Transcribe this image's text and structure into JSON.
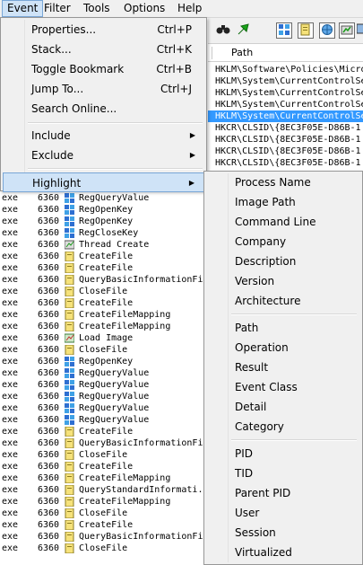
{
  "menubar": [
    {
      "label": "Event",
      "active": true
    },
    {
      "label": "Filter"
    },
    {
      "label": "Tools"
    },
    {
      "label": "Options"
    },
    {
      "label": "Help"
    }
  ],
  "toolbar": {
    "icons": [
      "binoculars-icon",
      "jump-arrow-icon",
      "registry-activity-icon",
      "file-activity-icon",
      "network-activity-icon",
      "process-activity-icon",
      "profiling-icon"
    ]
  },
  "column_header": {
    "path": "Path"
  },
  "path_rows": [
    {
      "text": "HKLM\\Software\\Policies\\Micro",
      "selected": false
    },
    {
      "text": "HKLM\\System\\CurrentControlSe",
      "selected": false
    },
    {
      "text": "HKLM\\System\\CurrentControlSe",
      "selected": false
    },
    {
      "text": "HKLM\\System\\CurrentControlSe",
      "selected": false
    },
    {
      "text": "HKLM\\System\\CurrentControlSe",
      "selected": true
    },
    {
      "text": "HKCR\\CLSID\\{8EC3F05E-D86B-1",
      "selected": false
    },
    {
      "text": "HKCR\\CLSID\\{8EC3F05E-D86B-1",
      "selected": false
    },
    {
      "text": "HKCR\\CLSID\\{8EC3F05E-D86B-1",
      "selected": false
    },
    {
      "text": "HKCR\\CLSID\\{8EC3F05E-D86B-1",
      "selected": false
    }
  ],
  "event_menu": {
    "items": [
      {
        "label": "Properties...",
        "accel": "Ctrl+P"
      },
      {
        "label": "Stack...",
        "accel": "Ctrl+K"
      },
      {
        "label": "Toggle Bookmark",
        "accel": "Ctrl+B"
      },
      {
        "label": "Jump To...",
        "accel": "Ctrl+J"
      },
      {
        "label": "Search Online...",
        "accel": ""
      },
      {
        "label": "Include",
        "accel": "",
        "submenu": true
      },
      {
        "label": "Exclude",
        "accel": "",
        "submenu": true
      },
      {
        "label": "Highlight",
        "accel": "",
        "submenu": true,
        "highlighted": true
      }
    ]
  },
  "highlight_submenu": {
    "groups": [
      [
        "Process Name",
        "Image Path",
        "Command Line",
        "Company",
        "Description",
        "Version",
        "Architecture"
      ],
      [
        "Path",
        "Operation",
        "Result",
        "Event Class",
        "Detail",
        "Category"
      ],
      [
        "PID",
        "TID",
        "Parent PID",
        "User",
        "Session",
        "Virtualized"
      ]
    ]
  },
  "event_rows": [
    {
      "proc": "exe",
      "pid": "6360",
      "icon": "registry-icon",
      "op": "RegQueryValue"
    },
    {
      "proc": "exe",
      "pid": "6360",
      "icon": "registry-icon",
      "op": "RegOpenKey"
    },
    {
      "proc": "exe",
      "pid": "6360",
      "icon": "registry-icon",
      "op": "RegOpenKey"
    },
    {
      "proc": "exe",
      "pid": "6360",
      "icon": "registry-icon",
      "op": "RegCloseKey"
    },
    {
      "proc": "exe",
      "pid": "6360",
      "icon": "thread-icon",
      "op": "Thread Create"
    },
    {
      "proc": "exe",
      "pid": "6360",
      "icon": "file-icon",
      "op": "CreateFile"
    },
    {
      "proc": "exe",
      "pid": "6360",
      "icon": "file-icon",
      "op": "CreateFile"
    },
    {
      "proc": "exe",
      "pid": "6360",
      "icon": "file-icon",
      "op": "QueryBasicInformationFi"
    },
    {
      "proc": "exe",
      "pid": "6360",
      "icon": "file-icon",
      "op": "CloseFile"
    },
    {
      "proc": "exe",
      "pid": "6360",
      "icon": "file-icon",
      "op": "CreateFile"
    },
    {
      "proc": "exe",
      "pid": "6360",
      "icon": "file-icon",
      "op": "CreateFileMapping"
    },
    {
      "proc": "exe",
      "pid": "6360",
      "icon": "file-icon",
      "op": "CreateFileMapping"
    },
    {
      "proc": "exe",
      "pid": "6360",
      "icon": "image-load-icon",
      "op": "Load Image"
    },
    {
      "proc": "exe",
      "pid": "6360",
      "icon": "file-icon",
      "op": "CloseFile"
    },
    {
      "proc": "exe",
      "pid": "6360",
      "icon": "registry-icon",
      "op": "RegOpenKey"
    },
    {
      "proc": "exe",
      "pid": "6360",
      "icon": "registry-icon",
      "op": "RegQueryValue"
    },
    {
      "proc": "exe",
      "pid": "6360",
      "icon": "registry-icon",
      "op": "RegQueryValue"
    },
    {
      "proc": "exe",
      "pid": "6360",
      "icon": "registry-icon",
      "op": "RegQueryValue"
    },
    {
      "proc": "exe",
      "pid": "6360",
      "icon": "registry-icon",
      "op": "RegQueryValue"
    },
    {
      "proc": "exe",
      "pid": "6360",
      "icon": "registry-icon",
      "op": "RegQueryValue"
    },
    {
      "proc": "exe",
      "pid": "6360",
      "icon": "file-icon",
      "op": "CreateFile"
    },
    {
      "proc": "exe",
      "pid": "6360",
      "icon": "file-icon",
      "op": "QueryBasicInformationFi"
    },
    {
      "proc": "exe",
      "pid": "6360",
      "icon": "file-icon",
      "op": "CloseFile"
    },
    {
      "proc": "exe",
      "pid": "6360",
      "icon": "file-icon",
      "op": "CreateFile"
    },
    {
      "proc": "exe",
      "pid": "6360",
      "icon": "file-icon",
      "op": "CreateFileMapping"
    },
    {
      "proc": "exe",
      "pid": "6360",
      "icon": "file-icon",
      "op": "QueryStandardInformati."
    },
    {
      "proc": "exe",
      "pid": "6360",
      "icon": "file-icon",
      "op": "CreateFileMapping"
    },
    {
      "proc": "exe",
      "pid": "6360",
      "icon": "file-icon",
      "op": "CloseFile"
    },
    {
      "proc": "exe",
      "pid": "6360",
      "icon": "file-icon",
      "op": "CreateFile"
    },
    {
      "proc": "exe",
      "pid": "6360",
      "icon": "file-icon",
      "op": "QueryBasicInformationFi"
    },
    {
      "proc": "exe",
      "pid": "6360",
      "icon": "file-icon",
      "op": "CloseFile"
    }
  ],
  "colors": {
    "selection": "#3399ff",
    "menu_bg": "#f0f0f0",
    "menu_hover": "#cfe3f7",
    "menu_hover_border": "#7aa7d6"
  }
}
